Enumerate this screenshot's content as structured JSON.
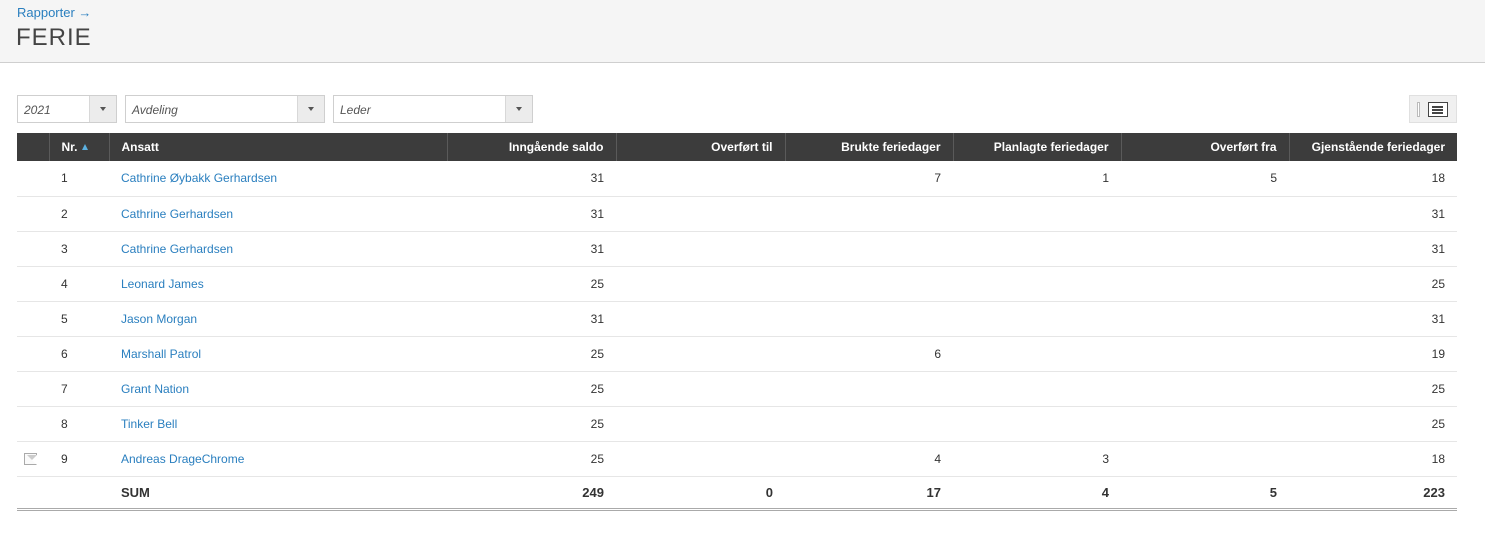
{
  "header": {
    "breadcrumb": "Rapporter →",
    "title": "FERIE"
  },
  "filters": {
    "year": "2021",
    "department_placeholder": "Avdeling",
    "manager_placeholder": "Leder"
  },
  "table": {
    "columns": {
      "nr": "Nr.",
      "employee": "Ansatt",
      "opening_balance": "Inngående saldo",
      "transferred_to": "Overført til",
      "used_days": "Brukte feriedager",
      "planned_days": "Planlagte feriedager",
      "transferred_from": "Overført fra",
      "remaining_days": "Gjenstående feriedager"
    },
    "rows": [
      {
        "nr": "1",
        "name": "Cathrine Øybakk Gerhardsen",
        "opening": "31",
        "to": "",
        "used": "7",
        "planned": "1",
        "from": "5",
        "remaining": "18",
        "note": false
      },
      {
        "nr": "2",
        "name": "Cathrine Gerhardsen",
        "opening": "31",
        "to": "",
        "used": "",
        "planned": "",
        "from": "",
        "remaining": "31",
        "note": false
      },
      {
        "nr": "3",
        "name": "Cathrine Gerhardsen",
        "opening": "31",
        "to": "",
        "used": "",
        "planned": "",
        "from": "",
        "remaining": "31",
        "note": false
      },
      {
        "nr": "4",
        "name": "Leonard James",
        "opening": "25",
        "to": "",
        "used": "",
        "planned": "",
        "from": "",
        "remaining": "25",
        "note": false
      },
      {
        "nr": "5",
        "name": "Jason Morgan",
        "opening": "31",
        "to": "",
        "used": "",
        "planned": "",
        "from": "",
        "remaining": "31",
        "note": false
      },
      {
        "nr": "6",
        "name": "Marshall Patrol",
        "opening": "25",
        "to": "",
        "used": "6",
        "planned": "",
        "from": "",
        "remaining": "19",
        "note": false
      },
      {
        "nr": "7",
        "name": "Grant Nation",
        "opening": "25",
        "to": "",
        "used": "",
        "planned": "",
        "from": "",
        "remaining": "25",
        "note": false
      },
      {
        "nr": "8",
        "name": "Tinker Bell",
        "opening": "25",
        "to": "",
        "used": "",
        "planned": "",
        "from": "",
        "remaining": "25",
        "note": false
      },
      {
        "nr": "9",
        "name": "Andreas DrageChrome",
        "opening": "25",
        "to": "",
        "used": "4",
        "planned": "3",
        "from": "",
        "remaining": "18",
        "note": true
      }
    ],
    "sum": {
      "label": "SUM",
      "opening": "249",
      "to": "0",
      "used": "17",
      "planned": "4",
      "from": "5",
      "remaining": "223"
    }
  }
}
